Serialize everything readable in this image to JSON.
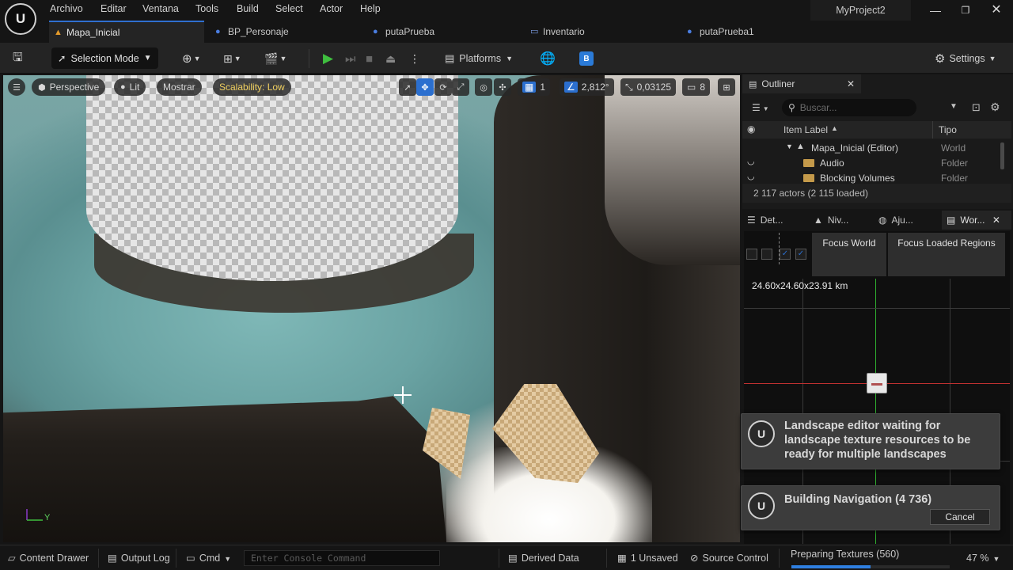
{
  "app": {
    "logo_text": "U",
    "project_name": "MyProject2",
    "menu": [
      "Archivo",
      "Editar",
      "Ventana",
      "Tools",
      "Build",
      "Select",
      "Actor",
      "Help"
    ]
  },
  "tabs": [
    {
      "label": "Mapa_Inicial",
      "icon": "level-icon",
      "active": true
    },
    {
      "label": "BP_Personaje",
      "icon": "blueprint-icon"
    },
    {
      "label": "putaPrueba",
      "icon": "blueprint-icon"
    },
    {
      "label": "Inventario",
      "icon": "widget-icon"
    },
    {
      "label": "putaPrueba1",
      "icon": "blueprint-icon"
    }
  ],
  "toolbar": {
    "selection_mode": "Selection Mode",
    "platforms": "Platforms",
    "settings": "Settings"
  },
  "viewport": {
    "perspective": "Perspective",
    "lit": "Lit",
    "show": "Mostrar",
    "scalability": "Scalability: Low",
    "grid_size": "1",
    "rotation_snap": "2,812°",
    "scale_snap": "0,03125",
    "camera_speed": "8",
    "axis_y_label": "Y"
  },
  "outliner": {
    "title": "Outliner",
    "search_placeholder": "Buscar...",
    "col_label": "Item Label",
    "col_type": "Tipo",
    "rows": [
      {
        "label": "Mapa_Inicial (Editor)",
        "type": "World"
      },
      {
        "label": "Audio",
        "type": "Folder"
      },
      {
        "label": "Blocking Volumes",
        "type": "Folder"
      }
    ],
    "actor_count": "2 117 actors (2 115 loaded)"
  },
  "lower_tabs": [
    {
      "label": "Det..."
    },
    {
      "label": "Niv..."
    },
    {
      "label": "Aju..."
    },
    {
      "label": "Wor..."
    }
  ],
  "world_partition": {
    "focus_world": "Focus World",
    "focus_loaded": "Focus Loaded Regions",
    "size": "24.60x24.60x23.91 km"
  },
  "notifications": [
    {
      "text": "Landscape editor waiting for landscape texture resources to be ready for multiple landscapes"
    },
    {
      "text": "Building Navigation (4 736)",
      "button": "Cancel"
    }
  ],
  "statusbar": {
    "content_drawer": "Content Drawer",
    "output_log": "Output Log",
    "cmd": "Cmd",
    "console_placeholder": "Enter Console Command",
    "derived_data": "Derived Data",
    "unsaved": "1 Unsaved",
    "source_control": "Source Control",
    "progress_label": "Preparing Textures (560)",
    "progress_fraction": 0.5,
    "zoom": "47 %"
  },
  "colors": {
    "accent": "#2f7fe0",
    "scalability_text": "#f0d060",
    "play_green": "#3fbf3f"
  }
}
